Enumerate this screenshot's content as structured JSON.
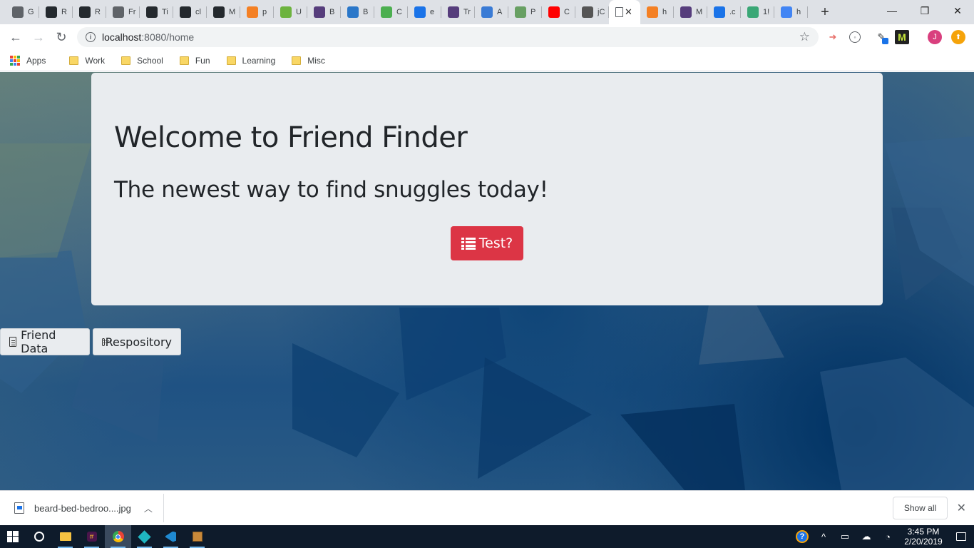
{
  "browser": {
    "tabs": [
      {
        "title": "G",
        "icon": "page-icon",
        "color": "#5f6368"
      },
      {
        "title": "R",
        "icon": "github-icon",
        "color": "#24292e"
      },
      {
        "title": "R",
        "icon": "github-icon",
        "color": "#24292e"
      },
      {
        "title": "Fr",
        "icon": "page-icon",
        "color": "#5f6368"
      },
      {
        "title": "Ti",
        "icon": "github-icon",
        "color": "#24292e"
      },
      {
        "title": "cl",
        "icon": "github-icon",
        "color": "#24292e"
      },
      {
        "title": "M",
        "icon": "github-icon",
        "color": "#24292e"
      },
      {
        "title": "p",
        "icon": "stackoverflow-icon",
        "color": "#f48024"
      },
      {
        "title": "U",
        "icon": "spring-icon",
        "color": "#6db33f"
      },
      {
        "title": "B",
        "icon": "bootstrap-icon",
        "color": "#563d7c"
      },
      {
        "title": "B",
        "icon": "bootstrap-cdn-icon",
        "color": "#2a77c9"
      },
      {
        "title": "C",
        "icon": "w3schools-icon",
        "color": "#4caf50"
      },
      {
        "title": "e",
        "icon": "flag-icon",
        "color": "#1a73e8"
      },
      {
        "title": "Tr",
        "icon": "bootstrap-icon",
        "color": "#563d7c"
      },
      {
        "title": "A",
        "icon": "grad-cap-icon",
        "color": "#3a7bd5"
      },
      {
        "title": "P",
        "icon": "node-icon",
        "color": "#68a063"
      },
      {
        "title": "C",
        "icon": "youtube-icon",
        "color": "#ff0000"
      },
      {
        "title": "jC",
        "icon": "shield-icon",
        "color": "#555555"
      }
    ],
    "active_tab": {
      "title": "",
      "close": "✕"
    },
    "tabs_after": [
      {
        "title": "h",
        "icon": "stackoverflow-icon",
        "color": "#f48024"
      },
      {
        "title": "M",
        "icon": "bootstrap-icon",
        "color": "#563d7c"
      },
      {
        "title": ".c",
        "icon": "wave-icon",
        "color": "#1a73e8"
      },
      {
        "title": "1!",
        "icon": "d-icon",
        "color": "#3aa776"
      },
      {
        "title": "h",
        "icon": "google-icon",
        "color": "#4285f4"
      }
    ],
    "new_tab": "+",
    "window_controls": {
      "minimize": "—",
      "maximize": "❐",
      "close": "✕"
    },
    "url": {
      "host": "localhost",
      "path": ":8080/home"
    },
    "bookmarks": [
      {
        "label": "Apps"
      },
      {
        "label": "Work"
      },
      {
        "label": "School"
      },
      {
        "label": "Fun"
      },
      {
        "label": "Learning"
      },
      {
        "label": "Misc"
      }
    ],
    "profile_initial": "J"
  },
  "page": {
    "title": "Welcome to Friend Finder",
    "subtitle": "The newest way to find snuggles today!",
    "test_button": "Test?",
    "friend_data_button": "Friend Data",
    "repository_button": "Respository",
    "accent_color": "#dc3545"
  },
  "downloads": {
    "file_name": "beard-bed-bedroo....jpg",
    "show_all": "Show all"
  },
  "taskbar": {
    "time": "3:45 PM",
    "date": "2/20/2019"
  }
}
